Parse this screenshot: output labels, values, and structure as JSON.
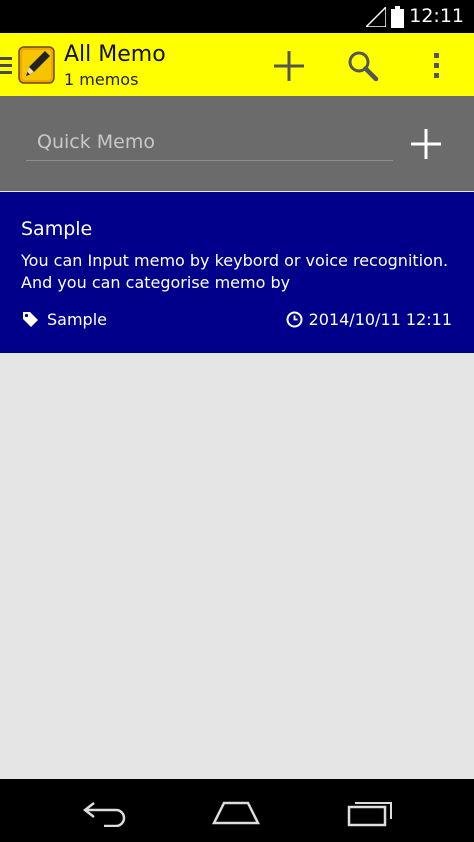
{
  "status_bar": {
    "time": "12:11"
  },
  "action_bar": {
    "title": "All Memo",
    "subtitle": "1 memos",
    "background": "#ffff00"
  },
  "quick_memo": {
    "placeholder": "Quick Memo",
    "value": ""
  },
  "memos": [
    {
      "title": "Sample",
      "body": "You can Input memo by keybord or voice recognition.  And you can categorise memo by",
      "tag": "Sample",
      "date": "2014/10/11 12:11",
      "background": "#00008b"
    }
  ],
  "icons": {
    "drawer": "hamburger-icon",
    "app": "pencil-memo-icon",
    "add": "plus-icon",
    "search": "magnifier-icon",
    "overflow": "more-vertical-icon",
    "tag": "tag-icon",
    "clock": "clock-icon",
    "back": "back-arrow-icon",
    "home": "home-icon",
    "recent": "recent-apps-icon"
  }
}
